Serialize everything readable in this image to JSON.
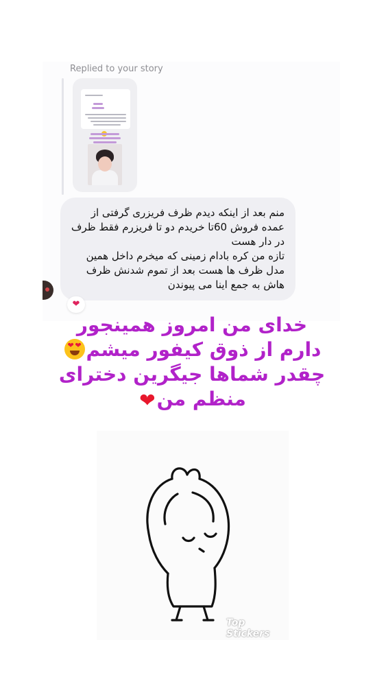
{
  "reply_header": {
    "text": "Replied to your story"
  },
  "message": {
    "text": "منم بعد از اینکه دیدم ظرف فریزری  گرفتی از عمده فروش 60تا خریدم دو تا فریزرم فقط ظرف در دار هست\nتازه من کره بادام زمینی که میخرم داخل همین مدل ظرف ها هست بعد از تموم شدنش ظرف هاش به جمع اینا می پیوندن"
  },
  "reaction": {
    "icon": "red-heart-icon",
    "glyph": "❤"
  },
  "caption": {
    "line1": "خدای من امروز همینجور",
    "line2": "دارم از ذوق کیفور میشم",
    "line3": "چقدر شماها جیگرین دخترای",
    "line4": "منظم من",
    "emoji1": "heart-eyes-icon",
    "emoji2": "red-heart-icon",
    "color": "#b122c9"
  },
  "sticker": {
    "watermark": "Top Stickers"
  },
  "colors": {
    "bubble": "#efeff3",
    "meta_text": "#8e8e93",
    "accent": "#b122c9"
  }
}
